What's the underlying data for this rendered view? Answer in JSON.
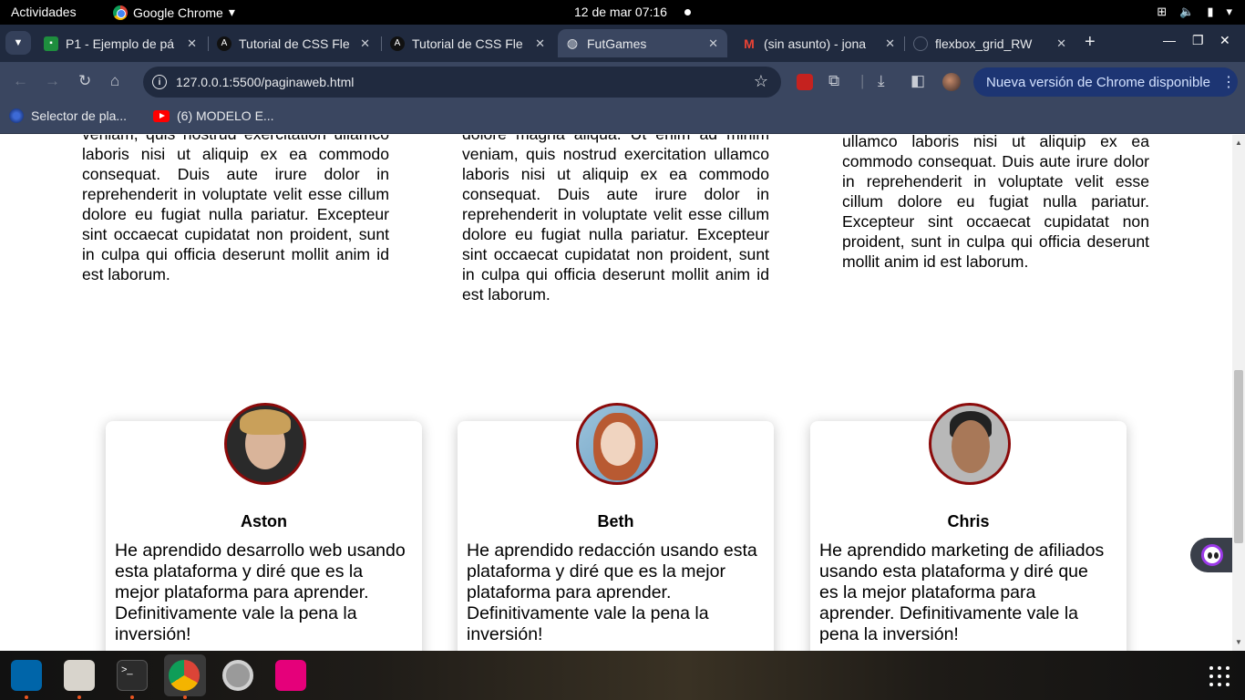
{
  "system": {
    "activities": "Actividades",
    "app_name": "Google Chrome",
    "clock": "12 de mar  07:16"
  },
  "tabs": [
    {
      "title": "P1 - Ejemplo de pá",
      "favicon": "google-classroom-icon",
      "active": false
    },
    {
      "title": "Tutorial de CSS Fle",
      "favicon": "codepen-icon",
      "active": false
    },
    {
      "title": "Tutorial de CSS Fle",
      "favicon": "codepen-icon",
      "active": false
    },
    {
      "title": "FutGames",
      "favicon": "globe-icon",
      "active": true
    },
    {
      "title": "(sin asunto) - jona",
      "favicon": "gmail-icon",
      "active": false
    },
    {
      "title": "flexbox_grid_RW",
      "favicon": "github-icon",
      "active": false
    }
  ],
  "toolbar": {
    "url": "127.0.0.1:5500/paginaweb.html",
    "update_label": "Nueva versión de Chrome disponible"
  },
  "bookmarks": [
    {
      "label": "Selector de pla...",
      "icon": "web-icon"
    },
    {
      "label": "(6) MODELO E...",
      "icon": "youtube-icon"
    }
  ],
  "columns": [
    "veniam, quis nostrud exercitation ullamco laboris nisi ut aliquip ex ea commodo consequat. Duis aute irure dolor in reprehenderit in voluptate velit esse cillum dolore eu fugiat nulla pariatur. Excepteur sint occaecat cupidatat non proident, sunt in culpa qui officia deserunt mollit anim id est laborum.",
    "dolore magna aliqua. Ut enim ad minim veniam, quis nostrud exercitation ullamco laboris nisi ut aliquip ex ea commodo consequat. Duis aute irure dolor in reprehenderit in voluptate velit esse cillum dolore eu fugiat nulla pariatur. Excepteur sint occaecat cupidatat non proident, sunt in culpa qui officia deserunt mollit anim id est laborum.",
    "ullamco laboris nisi ut aliquip ex ea commodo consequat. Duis aute irure dolor in reprehenderit in voluptate velit esse cillum dolore eu fugiat nulla pariatur. Excepteur sint occaecat cupidatat non proident, sunt in culpa qui officia deserunt mollit anim id est laborum."
  ],
  "testimonials": [
    {
      "name": "Aston",
      "quote": "He aprendido desarrollo web usando esta plataforma y diré que es la mejor plataforma para aprender. Definitivamente vale la pena la inversión!"
    },
    {
      "name": "Beth",
      "quote": "He aprendido redacción usando esta plataforma y diré que es la mejor plataforma para aprender. Definitivamente vale la pena la inversión!"
    },
    {
      "name": "Chris",
      "quote": "He aprendido marketing de afiliados usando esta plataforma y diré que es la mejor plataforma para aprender. Definitivamente vale la pena la inversión!"
    }
  ],
  "colors": {
    "photo_border": "#8b0a0a",
    "tab_bar": "#202a3f",
    "toolbar": "#3a4660",
    "update_button": "#1d3573"
  }
}
